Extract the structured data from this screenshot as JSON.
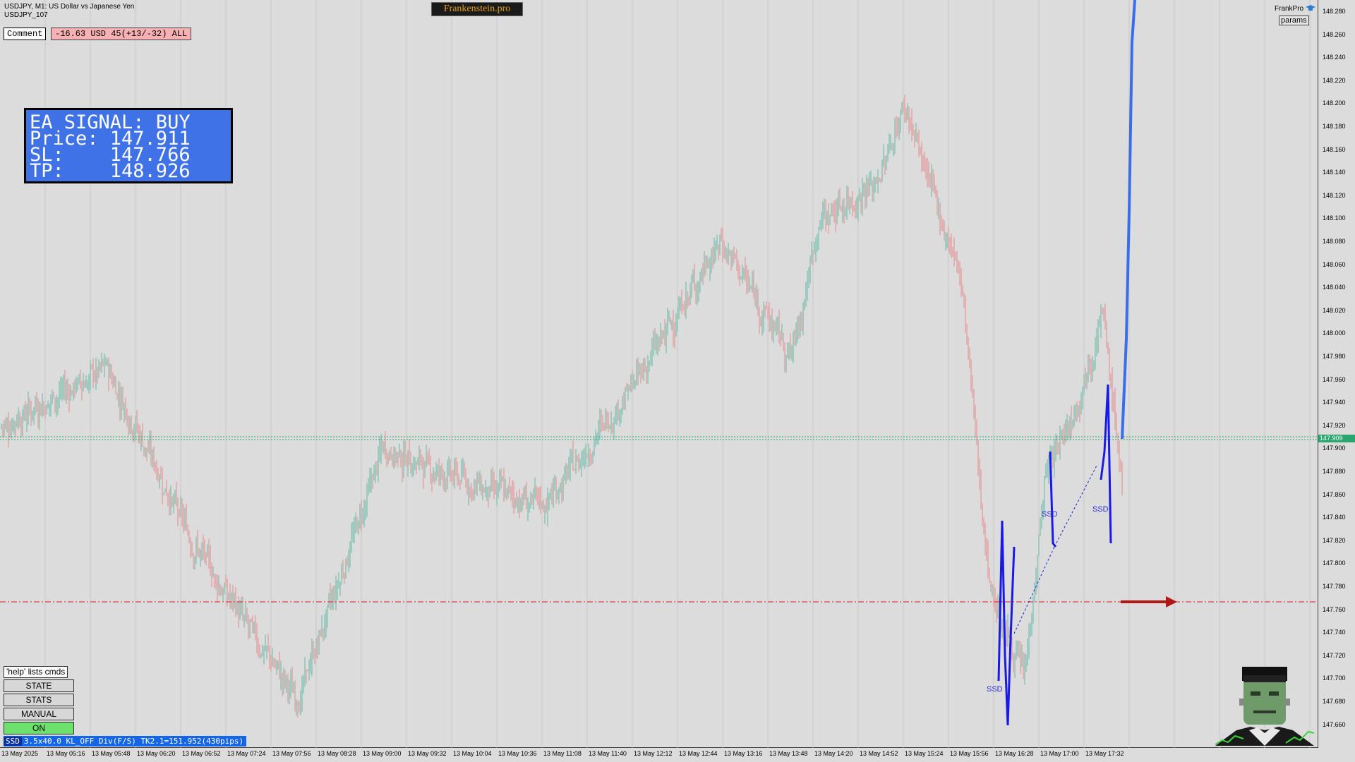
{
  "header": {
    "symbol_line": "USDJPY, M1:  US Dollar vs Japanese Yen",
    "account_line": "USDJPY_107",
    "brand": "Frankenstein.pro"
  },
  "comment": {
    "label": "Comment",
    "value": "-16.63 USD 45(+13/-32) ALL"
  },
  "signal": {
    "line1": "EA SIGNAL: BUY",
    "line2": "Price: 147.911",
    "line3": "SL:    147.766",
    "line4": "TP:    148.926"
  },
  "top_right": {
    "name": "FrankPro",
    "params_label": "params",
    "icon": "graduation-cap-icon"
  },
  "controls": {
    "help": "'help' lists cmds",
    "state": "STATE",
    "stats": "STATS",
    "manual": "MANUAL",
    "on": "ON"
  },
  "status_bar": {
    "tag": "SSD",
    "text": "3.5x40.0 KL_OFF Div(F/S) TK2.1=151.952(430pips)"
  },
  "price_axis": [
    "148.280",
    "148.260",
    "148.240",
    "148.220",
    "148.200",
    "148.180",
    "148.160",
    "148.140",
    "148.120",
    "148.100",
    "148.080",
    "148.060",
    "148.040",
    "148.020",
    "148.000",
    "147.980",
    "147.960",
    "147.940",
    "147.920",
    "147.900",
    "147.880",
    "147.860",
    "147.840",
    "147.820",
    "147.800",
    "147.780",
    "147.760",
    "147.740",
    "147.720",
    "147.700",
    "147.680",
    "147.660"
  ],
  "current_price": "147.909",
  "time_axis": [
    "13 May 2025",
    "13 May 05:16",
    "13 May 05:48",
    "13 May 06:20",
    "13 May 06:52",
    "13 May 07:24",
    "13 May 07:56",
    "13 May 08:28",
    "13 May 09:00",
    "13 May 09:32",
    "13 May 10:04",
    "13 May 10:36",
    "13 May 11:08",
    "13 May 11:40",
    "13 May 12:12",
    "13 May 12:44",
    "13 May 13:16",
    "13 May 13:48",
    "13 May 14:20",
    "13 May 14:52",
    "13 May 15:24",
    "13 May 15:56",
    "13 May 16:28",
    "13 May 17:00",
    "13 May 17:32"
  ],
  "annotations": {
    "ssd_label": "SSD"
  },
  "colors": {
    "bull": "#5fb8a5",
    "bear": "#e6888a",
    "entry_line": "#2aa56d",
    "sl_line": "#d22222",
    "zigzag": "#1a1ae6",
    "tp_line": "#3a6ee8"
  }
}
